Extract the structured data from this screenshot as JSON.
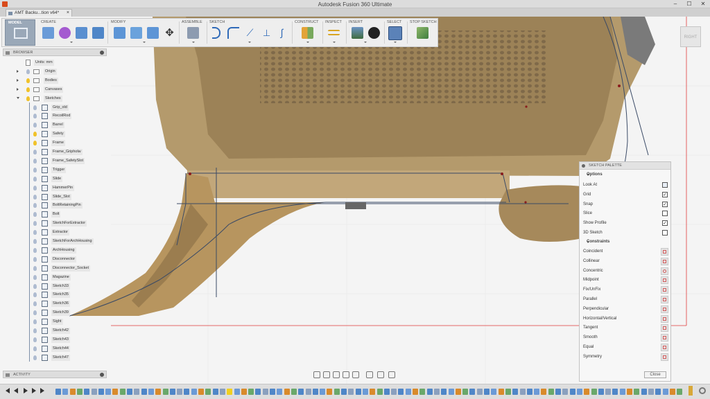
{
  "window": {
    "title": "Autodesk Fusion 360 Ultimate",
    "minimize": "–",
    "maximize": "☐",
    "close": "✕"
  },
  "document_tab": {
    "label": "AMT Backu...tion v64*",
    "close": "×"
  },
  "toolbar": {
    "workspace": "MODEL",
    "groups": [
      {
        "label": "CREATE"
      },
      {
        "label": "MODIFY"
      },
      {
        "label": "ASSEMBLE"
      },
      {
        "label": "SKETCH"
      },
      {
        "label": "CONSTRUCT"
      },
      {
        "label": "INSPECT"
      },
      {
        "label": "INSERT"
      },
      {
        "label": "SELECT"
      },
      {
        "label": "STOP SKETCH"
      }
    ]
  },
  "viewcube": {
    "face": "RIGHT"
  },
  "browser": {
    "title": "BROWSER",
    "units": "Units: mm",
    "folders": [
      {
        "label": "Origin"
      },
      {
        "label": "Bodies"
      },
      {
        "label": "Canvases"
      },
      {
        "label": "Sketches"
      }
    ],
    "sketches": [
      {
        "label": "Grip_old"
      },
      {
        "label": "RecoilRod"
      },
      {
        "label": "Barrel"
      },
      {
        "label": "Safety"
      },
      {
        "label": "Frame"
      },
      {
        "label": "Frame_Gripholw"
      },
      {
        "label": "Frame_SafetySlot"
      },
      {
        "label": "Trigger"
      },
      {
        "label": "Slide"
      },
      {
        "label": "HammerPin"
      },
      {
        "label": "Slide_Slot"
      },
      {
        "label": "BoltRetainingPin"
      },
      {
        "label": "Bolt"
      },
      {
        "label": "SketchForExtractor"
      },
      {
        "label": "Extractor"
      },
      {
        "label": "SketchForArchHousing"
      },
      {
        "label": "ArchHousing"
      },
      {
        "label": "Disconnector"
      },
      {
        "label": "Disconnector_Socket"
      },
      {
        "label": "Magazine"
      },
      {
        "label": "Sketch33"
      },
      {
        "label": "Sketch35"
      },
      {
        "label": "Sketch36"
      },
      {
        "label": "Sketch39"
      },
      {
        "label": "Sight"
      },
      {
        "label": "Sketch42"
      },
      {
        "label": "Sketch43"
      },
      {
        "label": "Sketch44"
      },
      {
        "label": "Sketch47"
      }
    ]
  },
  "activity": {
    "title": "ACTIVITY"
  },
  "sketch_palette": {
    "title": "SKETCH PALETTE",
    "options_header": "Options",
    "options": [
      {
        "label": "Look At",
        "control": "button"
      },
      {
        "label": "Grid",
        "control": "checkbox",
        "checked": true
      },
      {
        "label": "Snap",
        "control": "checkbox",
        "checked": true
      },
      {
        "label": "Slice",
        "control": "checkbox",
        "checked": false
      },
      {
        "label": "Show Profile",
        "control": "checkbox",
        "checked": true
      },
      {
        "label": "3D Sketch",
        "control": "checkbox",
        "checked": false
      }
    ],
    "constraints_header": "Constraints",
    "constraints": [
      {
        "label": "Coincident"
      },
      {
        "label": "Collinear"
      },
      {
        "label": "Concentric"
      },
      {
        "label": "Midpoint"
      },
      {
        "label": "Fix/UnFix"
      },
      {
        "label": "Parallel"
      },
      {
        "label": "Perpendicular"
      },
      {
        "label": "Horizontal/Vertical"
      },
      {
        "label": "Tangent"
      },
      {
        "label": "Smooth"
      },
      {
        "label": "Equal"
      },
      {
        "label": "Symmetry"
      }
    ],
    "close_label": "Close"
  },
  "colors": {
    "canvas_bg": "#f4f4f4",
    "model_tan": "#b79e70",
    "sketch_line": "#3a4a66",
    "axis_red": "#e03a3a",
    "highlight": "#f0d020"
  }
}
